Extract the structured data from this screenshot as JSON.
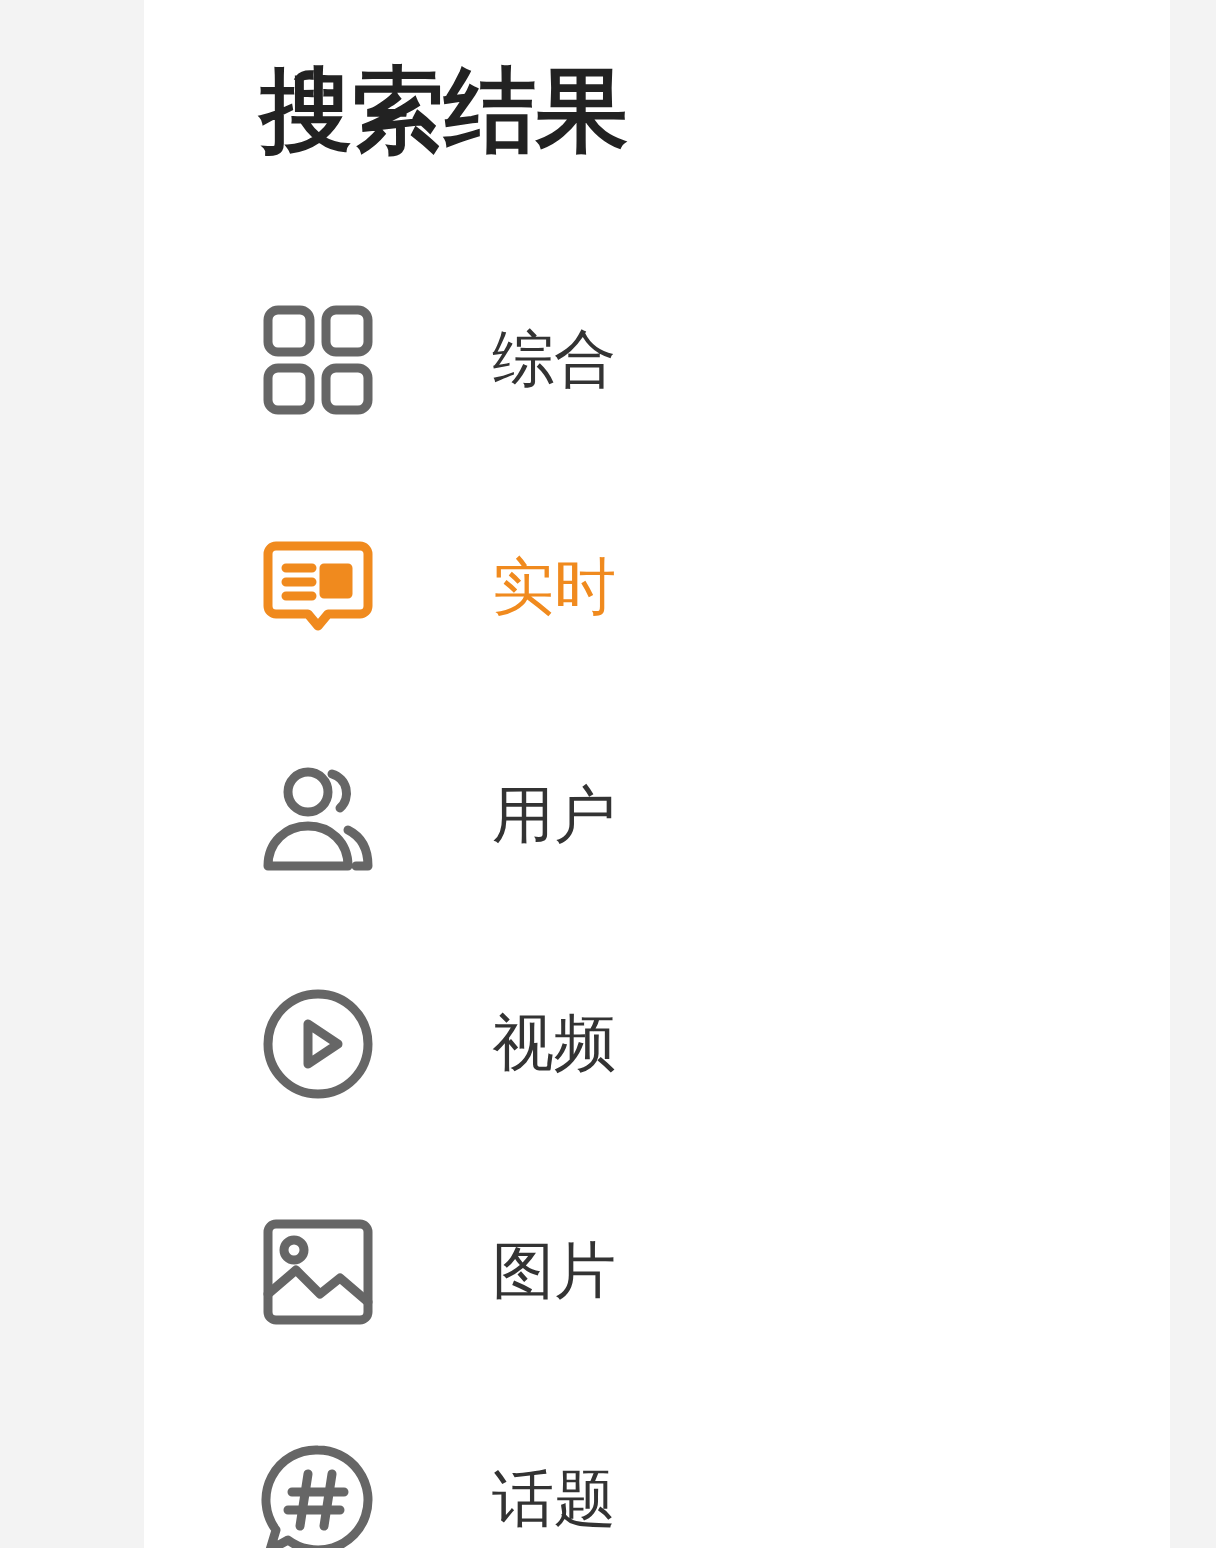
{
  "title": "搜索结果",
  "items": [
    {
      "label": "综合",
      "selected": false
    },
    {
      "label": "实时",
      "selected": true
    },
    {
      "label": "用户",
      "selected": false
    },
    {
      "label": "视频",
      "selected": false
    },
    {
      "label": "图片",
      "selected": false
    },
    {
      "label": "话题",
      "selected": false
    }
  ]
}
